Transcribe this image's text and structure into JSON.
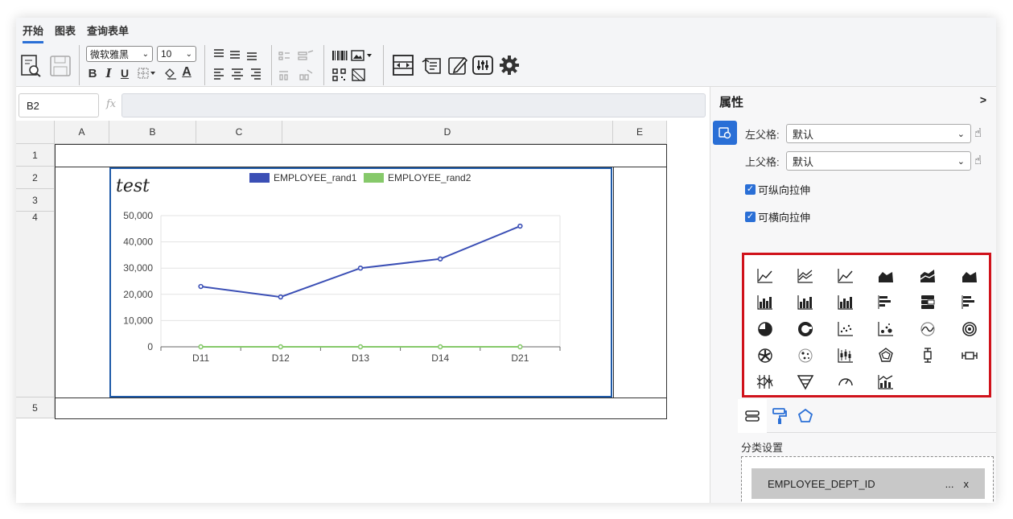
{
  "tabs": [
    "开始",
    "图表",
    "查询表单"
  ],
  "toolbar": {
    "font_family": "微软雅黑",
    "font_size": "10",
    "bold": "B",
    "italic": "I",
    "underline": "U"
  },
  "formula_bar": {
    "cell_ref": "B2",
    "fx": "fx",
    "formula": ""
  },
  "grid": {
    "columns": [
      "A",
      "B",
      "C",
      "D",
      "E"
    ],
    "rows": [
      "1",
      "2",
      "3",
      "4",
      "5"
    ]
  },
  "chart_data": {
    "type": "line",
    "title": "test",
    "categories": [
      "D11",
      "D12",
      "D13",
      "D14",
      "D21"
    ],
    "series": [
      {
        "name": "EMPLOYEE_rand1",
        "color": "#3b4fb5",
        "values": [
          23000,
          19000,
          30000,
          33500,
          46000
        ]
      },
      {
        "name": "EMPLOYEE_rand2",
        "color": "#86c96a",
        "values": [
          0,
          0,
          0,
          0,
          0
        ]
      }
    ],
    "yticks": [
      "0",
      "10,000",
      "20,000",
      "30,000",
      "40,000",
      "50,000"
    ],
    "ylim": [
      0,
      50000
    ],
    "grid": true,
    "legend": "top-center"
  },
  "panel": {
    "title": "属性",
    "toggle": ">",
    "left_parent_label": "左父格:",
    "left_parent_value": "默认",
    "top_parent_label": "上父格:",
    "top_parent_value": "默认",
    "vertical_stretch": "可纵向拉伸",
    "horizontal_stretch": "可横向拉伸",
    "category_section": "分类设置",
    "category_field": "EMPLOYEE_DEPT_ID",
    "field_more": "...",
    "field_remove": "x"
  },
  "chart_type_icons": [
    "line-icon",
    "multi-line-icon",
    "step-line-icon",
    "area-icon",
    "stacked-area-icon",
    "mountain-area-icon",
    "column-icon",
    "grouped-column-icon",
    "stacked-column-icon",
    "bar-icon",
    "stacked-bar-icon",
    "horizontal-bar-icon",
    "pie-icon",
    "donut-icon",
    "scatter-icon",
    "bubble-icon",
    "wave-icon",
    "rose-icon",
    "radial-icon",
    "dots-circle-icon",
    "candlestick-icon",
    "radar-icon",
    "boxplot-icon",
    "horizontal-boxplot-icon",
    "parallel-icon",
    "funnel-icon",
    "gauge-icon",
    "combo-icon"
  ]
}
